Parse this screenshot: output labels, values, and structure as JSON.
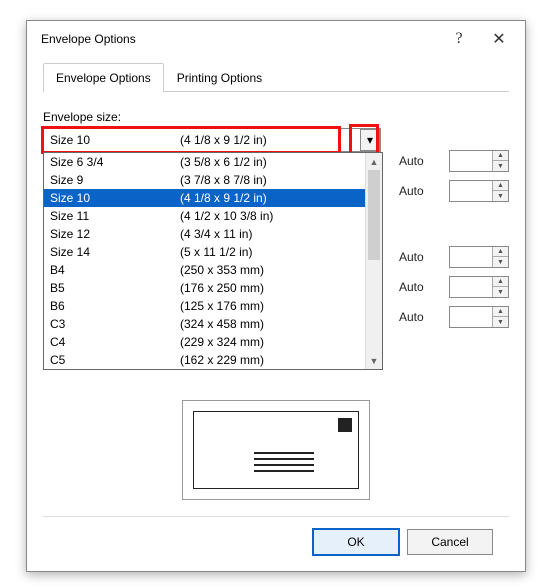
{
  "dialog": {
    "title": "Envelope Options",
    "help_symbol": "?",
    "close_symbol": "✕"
  },
  "tabs": {
    "active": "Envelope Options",
    "other": "Printing Options"
  },
  "section": {
    "label": "Envelope size:"
  },
  "combo": {
    "selected_name": "Size 10",
    "selected_dims": "(4 1/8 x 9 1/2 in)",
    "chevron": "▾"
  },
  "dropdown_items": [
    {
      "name": "Size 6 3/4",
      "dims": "(3 5/8 x 6 1/2 in)",
      "selected": false
    },
    {
      "name": "Size 9",
      "dims": "(3 7/8 x 8 7/8 in)",
      "selected": false
    },
    {
      "name": "Size 10",
      "dims": "(4 1/8 x 9 1/2 in)",
      "selected": true
    },
    {
      "name": "Size 11",
      "dims": "(4 1/2 x 10 3/8 in)",
      "selected": false
    },
    {
      "name": "Size 12",
      "dims": "(4 3/4 x 11 in)",
      "selected": false
    },
    {
      "name": "Size 14",
      "dims": "(5 x 11 1/2 in)",
      "selected": false
    },
    {
      "name": "B4",
      "dims": "(250 x 353 mm)",
      "selected": false
    },
    {
      "name": "B5",
      "dims": "(176 x 250 mm)",
      "selected": false
    },
    {
      "name": "B6",
      "dims": "(125 x 176 mm)",
      "selected": false
    },
    {
      "name": "C3",
      "dims": "(324 x 458 mm)",
      "selected": false
    },
    {
      "name": "C4",
      "dims": "(229 x 324 mm)",
      "selected": false
    },
    {
      "name": "C5",
      "dims": "(162 x 229 mm)",
      "selected": false
    }
  ],
  "fields": [
    {
      "label": "Auto"
    },
    {
      "label": "Auto"
    },
    {
      "label": "Auto"
    },
    {
      "label": "Auto"
    },
    {
      "label": "Auto"
    }
  ],
  "buttons": {
    "ok": "OK",
    "cancel": "Cancel"
  },
  "arrows": {
    "up": "▲",
    "down": "▼"
  }
}
